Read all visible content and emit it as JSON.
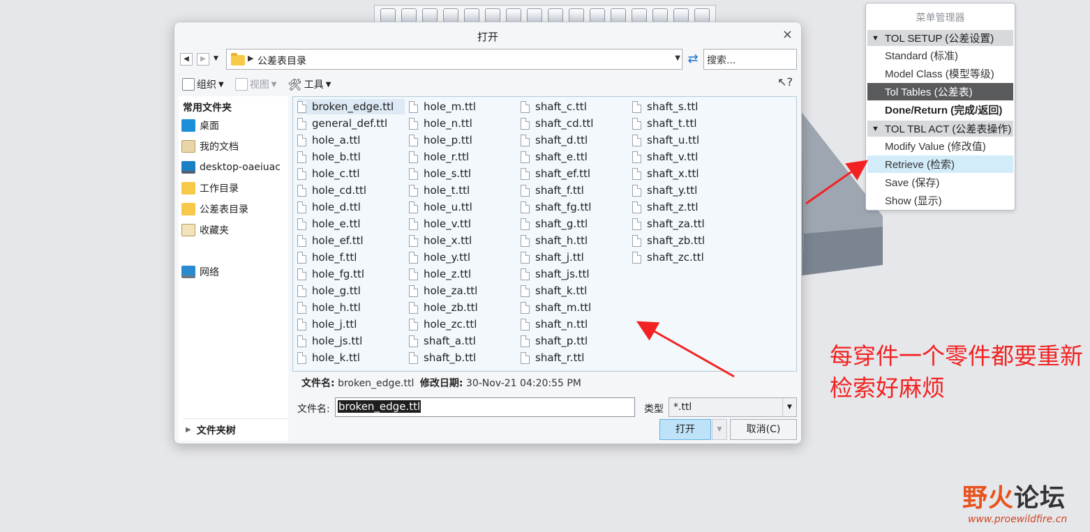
{
  "dialog": {
    "title": "打开",
    "close": "×",
    "address": "公差表目录",
    "search_placeholder": "搜索...",
    "commands": {
      "organize": "组织",
      "view": "视图",
      "tools": "工具"
    },
    "sidebar": {
      "heading": "常用文件夹",
      "items": [
        "桌面",
        "我的文档",
        "desktop-oaeiuac",
        "工作目录",
        "公差表目录",
        "收藏夹",
        "网络"
      ],
      "tree": "文件夹树"
    },
    "files": [
      "broken_edge.ttl",
      "general_def.ttl",
      "hole_a.ttl",
      "hole_b.ttl",
      "hole_c.ttl",
      "hole_cd.ttl",
      "hole_d.ttl",
      "hole_e.ttl",
      "hole_ef.ttl",
      "hole_f.ttl",
      "hole_fg.ttl",
      "hole_g.ttl",
      "hole_h.ttl",
      "hole_j.ttl",
      "hole_js.ttl",
      "hole_k.ttl",
      "hole_m.ttl",
      "hole_n.ttl",
      "hole_p.ttl",
      "hole_r.ttl",
      "hole_s.ttl",
      "hole_t.ttl",
      "hole_u.ttl",
      "hole_v.ttl",
      "hole_x.ttl",
      "hole_y.ttl",
      "hole_z.ttl",
      "hole_za.ttl",
      "hole_zb.ttl",
      "hole_zc.ttl",
      "shaft_a.ttl",
      "shaft_b.ttl",
      "shaft_c.ttl",
      "shaft_cd.ttl",
      "shaft_d.ttl",
      "shaft_e.ttl",
      "shaft_ef.ttl",
      "shaft_f.ttl",
      "shaft_fg.ttl",
      "shaft_g.ttl",
      "shaft_h.ttl",
      "shaft_j.ttl",
      "shaft_js.ttl",
      "shaft_k.ttl",
      "shaft_m.ttl",
      "shaft_n.ttl",
      "shaft_p.ttl",
      "shaft_r.ttl",
      "shaft_s.ttl",
      "shaft_t.ttl",
      "shaft_u.ttl",
      "shaft_v.ttl",
      "shaft_x.ttl",
      "shaft_y.ttl",
      "shaft_z.ttl",
      "shaft_za.ttl",
      "shaft_zb.ttl",
      "shaft_zc.ttl"
    ],
    "selected_file": "broken_edge.ttl",
    "details": {
      "name_label": "文件名:",
      "name_value": "broken_edge.ttl",
      "date_label": "修改日期:",
      "date_value": "30-Nov-21 04:20:55 PM"
    },
    "filename_label": "文件名:",
    "filename_value": "broken_edge.ttl",
    "type_label": "类型",
    "type_value": "*.ttl",
    "open_button": "打开",
    "cancel_button": "取消(C)"
  },
  "menu_manager": {
    "title": "菜单管理器",
    "section1": "TOL SETUP (公差设置)",
    "section1_items": [
      "Standard (标准)",
      "Model Class (模型等级)",
      "Tol Tables (公差表)",
      "Done/Return (完成/返回)"
    ],
    "section2": "TOL TBL ACT (公差表操作)",
    "section2_items": [
      "Modify Value (修改值)",
      "Retrieve (检索)",
      "Save (保存)",
      "Show (显示)"
    ]
  },
  "annotation": "每穿件一个零件都要重新检索好麻烦",
  "watermark": {
    "text_a": "野火",
    "text_b": "论坛",
    "url": "www.proewildfire.cn"
  },
  "colors": {
    "annotation": "#f22222",
    "active_menu": "#595a5c",
    "hover_menu": "#d2ecfa",
    "open_button": "#bee3f8"
  }
}
